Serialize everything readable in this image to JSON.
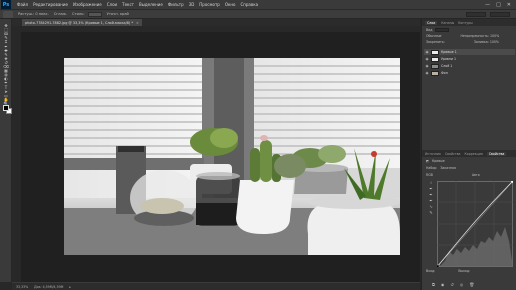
{
  "app": {
    "logo": "Ps",
    "menu": [
      "Файл",
      "Редактирование",
      "Изображение",
      "Слои",
      "Текст",
      "Выделение",
      "Фильтр",
      "3D",
      "Просмотр",
      "Окно",
      "Справка"
    ],
    "window_controls": [
      "—",
      "□",
      "✕"
    ]
  },
  "options": {
    "mode_label": "Растуш.: 0 пикс.",
    "aa_label": "Сглаж.",
    "style_label": "Стиль:",
    "right_btn": "Уточн. край"
  },
  "document": {
    "tab_title": "photo-7784291-7882.jpg @ 33,3% (Кривые 1, Слой-маска/8) *",
    "tab_close": "×"
  },
  "status": {
    "zoom": "33,33%",
    "doc_size": "Док: 4,59M/4,59M",
    "arrow": "▸"
  },
  "tools": [
    "move-icon",
    "marquee-icon",
    "lasso-icon",
    "quick-select-icon",
    "crop-icon",
    "eyedropper-icon",
    "healing-icon",
    "brush-icon",
    "stamp-icon",
    "history-brush-icon",
    "eraser-icon",
    "gradient-icon",
    "blur-icon",
    "dodge-icon",
    "pen-icon",
    "type-icon",
    "path-select-icon",
    "shape-icon",
    "hand-icon",
    "zoom-icon"
  ],
  "tool_glyphs": [
    "✥",
    "⬚",
    "ꝏ",
    "✎",
    "⌗",
    "✒",
    "✚",
    "✎",
    "⎈",
    "↺",
    "⌫",
    "▦",
    "◍",
    "◐",
    "✒",
    "T",
    "➤",
    "▭",
    "✋",
    "🔍"
  ],
  "layers_panel": {
    "tabs": [
      "Слои",
      "Каналы",
      "Контуры"
    ],
    "active_tab": "Слои",
    "kind_label": "Вид",
    "blend_mode": "Обычные",
    "opacity_label": "Непрозрачность: 100%",
    "lock_label": "Закрепить:",
    "fill_label": "Заливка: 100%",
    "layers": [
      {
        "name": "Кривые 1",
        "thumb_color": "#eaeaea",
        "selected": true
      },
      {
        "name": "Уровни 1",
        "thumb_color": "#eaeaea",
        "selected": false
      },
      {
        "name": "Слой 1",
        "thumb_color": "#8a8a8a",
        "selected": false
      },
      {
        "name": "Фон",
        "thumb_color": "#b9b1a2",
        "selected": false
      }
    ]
  },
  "properties_panel": {
    "tabs": [
      "Источник",
      "Свойства",
      "Коррекция",
      "Свойства"
    ],
    "active_tab": "Свойства",
    "title": "Кривые",
    "preset_label": "Набор:",
    "preset_value": "Заказная",
    "channel_value": "RGB",
    "auto_label": "Авто",
    "input_label": "Вход:",
    "output_label": "Выход:"
  },
  "colors": {
    "panel_bg": "#3a3a3a",
    "canvas_bg": "#282828",
    "accent": "#31a8ff"
  }
}
